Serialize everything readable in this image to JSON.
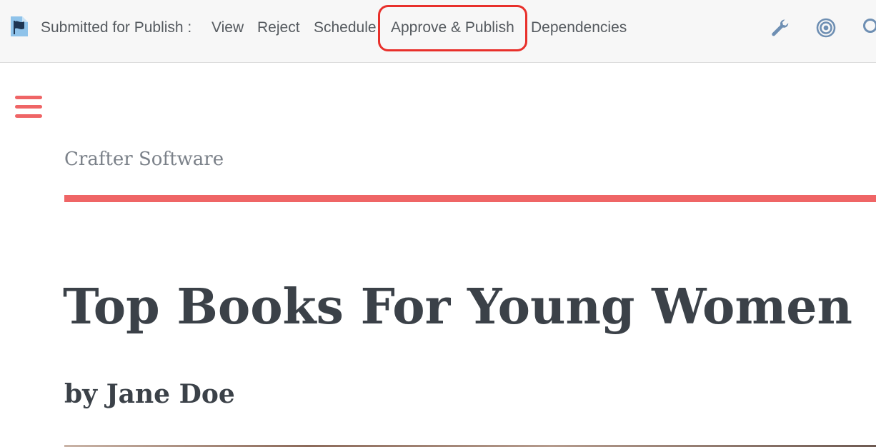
{
  "toolbar": {
    "status_icon": "flag-document-icon",
    "status_label": "Submitted for Publish :",
    "actions": {
      "view": "View",
      "reject": "Reject",
      "schedule": "Schedule",
      "approve_publish": "Approve & Publish",
      "dependencies": "Dependencies"
    },
    "highlight_color": "#e8302b",
    "tools": [
      "wrench-icon",
      "target-icon",
      "search-icon"
    ]
  },
  "site": {
    "menu_icon": "hamburger-menu-icon",
    "name": "Crafter Software",
    "accent_color": "#ef6566"
  },
  "article": {
    "title": "Top Books For Young Women",
    "byline": "by Jane Doe"
  }
}
